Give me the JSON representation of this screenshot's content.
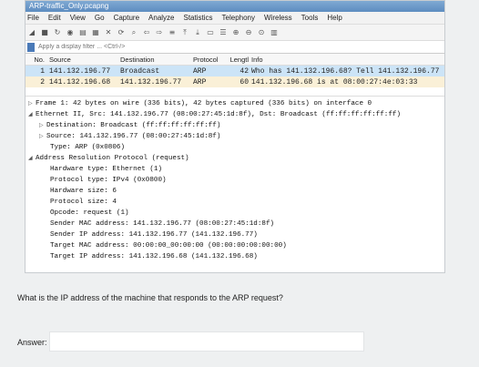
{
  "window": {
    "title": "ARP-traffic_Only.pcapng"
  },
  "menu": [
    "File",
    "Edit",
    "View",
    "Go",
    "Capture",
    "Analyze",
    "Statistics",
    "Telephony",
    "Wireless",
    "Tools",
    "Help"
  ],
  "filter": {
    "placeholder": "Apply a display filter ... <Ctrl-/>"
  },
  "packet_list": {
    "headers": [
      "No.",
      "Source",
      "Destination",
      "Protocol",
      "Lengtl",
      "Info"
    ],
    "rows": [
      {
        "no": "1",
        "src": "141.132.196.77",
        "dst": "Broadcast",
        "proto": "ARP",
        "len": "42",
        "info": "Who has 141.132.196.68? Tell 141.132.196.77"
      },
      {
        "no": "2",
        "src": "141.132.196.68",
        "dst": "141.132.196.77",
        "proto": "ARP",
        "len": "60",
        "info": "141.132.196.68 is at 08:00:27:4e:03:33"
      }
    ]
  },
  "details": {
    "frame": "Frame 1: 42 bytes on wire (336 bits), 42 bytes captured (336 bits) on interface 0",
    "ethernet": "Ethernet II, Src: 141.132.196.77 (08:00:27:45:1d:8f), Dst: Broadcast (ff:ff:ff:ff:ff:ff)",
    "eth_dst": "Destination: Broadcast (ff:ff:ff:ff:ff:ff)",
    "eth_src": "Source: 141.132.196.77 (08:00:27:45:1d:8f)",
    "eth_type": "Type: ARP (0x0806)",
    "arp": "Address Resolution Protocol (request)",
    "hw_type": "Hardware type: Ethernet (1)",
    "proto_type": "Protocol type: IPv4 (0x0800)",
    "hw_size": "Hardware size: 6",
    "proto_size": "Protocol size: 4",
    "opcode": "Opcode: request (1)",
    "sender_mac": "Sender MAC address: 141.132.196.77 (08:00:27:45:1d:8f)",
    "sender_ip": "Sender IP address: 141.132.196.77 (141.132.196.77)",
    "target_mac": "Target MAC address: 00:00:00_00:00:00 (00:00:00:00:00:00)",
    "target_ip": "Target IP address: 141.132.196.68 (141.132.196.68)"
  },
  "quiz": {
    "question": "What is the IP address of the machine that responds to the ARP request?",
    "answer_label": "Answer:",
    "answer_value": ""
  }
}
